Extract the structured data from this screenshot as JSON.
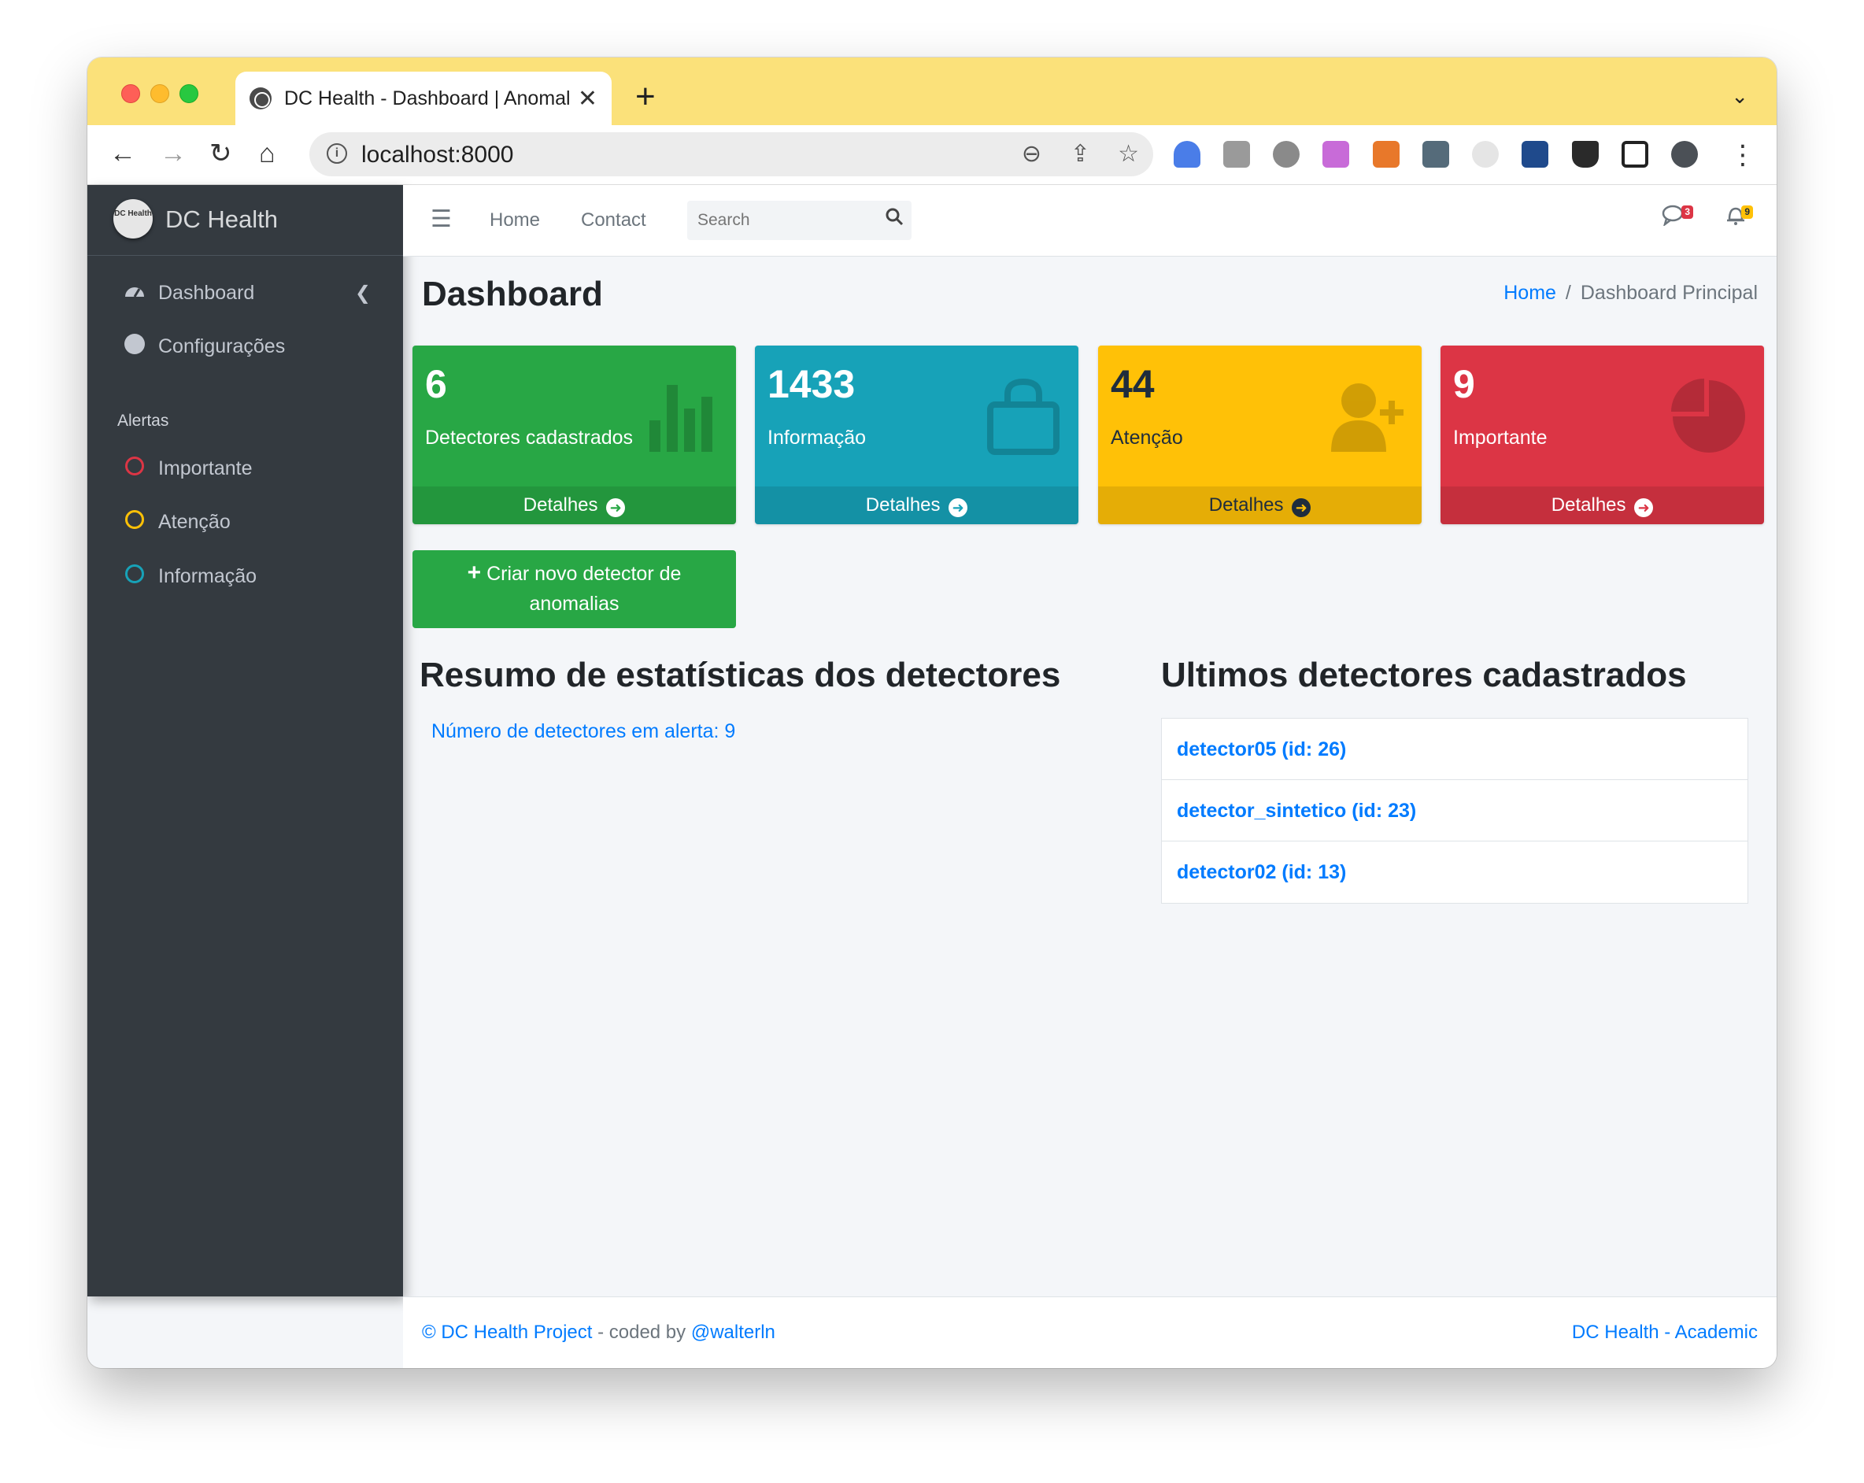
{
  "browser": {
    "tab_title": "DC Health - Dashboard | Anomalias",
    "url": "localhost:8000"
  },
  "sidebar": {
    "brand_logo_text": "DC Health",
    "brand": "DC Health",
    "items": [
      {
        "label": "Dashboard"
      },
      {
        "label": "Configurações"
      }
    ],
    "alerts_header": "Alertas",
    "alerts": [
      {
        "label": "Importante",
        "color": "#dc3545"
      },
      {
        "label": "Atenção",
        "color": "#ffc107"
      },
      {
        "label": "Informação",
        "color": "#17a2b8"
      }
    ]
  },
  "navbar": {
    "links": [
      "Home",
      "Contact"
    ],
    "search_placeholder": "Search",
    "messages_badge": "3",
    "notifications_badge": "9"
  },
  "page": {
    "title": "Dashboard",
    "breadcrumb": {
      "home": "Home",
      "separator": "/",
      "current": "Dashboard Principal"
    }
  },
  "boxes": [
    {
      "value": "6",
      "label": "Detectores cadastrados",
      "footer": "Detalhes",
      "color": "#28a745",
      "icon": "bar-chart-icon"
    },
    {
      "value": "1433",
      "label": "Informação",
      "footer": "Detalhes",
      "color": "#17a2b8",
      "icon": "shopping-bag-icon"
    },
    {
      "value": "44",
      "label": "Atenção",
      "footer": "Detalhes",
      "color": "#ffc107",
      "icon": "user-plus-icon"
    },
    {
      "value": "9",
      "label": "Importante",
      "footer": "Detalhes",
      "color": "#dc3545",
      "icon": "pie-chart-icon"
    }
  ],
  "create_button": {
    "line1": "Criar novo detector de",
    "line2": "anomalias"
  },
  "stats": {
    "title": "Resumo de estatísticas dos detectores",
    "alert_count": "Número de detectores em alerta: 9"
  },
  "recent": {
    "title": "Ultimos detectores cadastrados",
    "items": [
      "detector05 (id: 26)",
      "detector_sintetico (id: 23)",
      "detector02 (id: 13)"
    ]
  },
  "footer": {
    "copyright": "© DC Health Project",
    "coded_by": " - coded by ",
    "author": "@walterln",
    "right": "DC Health - Academic"
  }
}
